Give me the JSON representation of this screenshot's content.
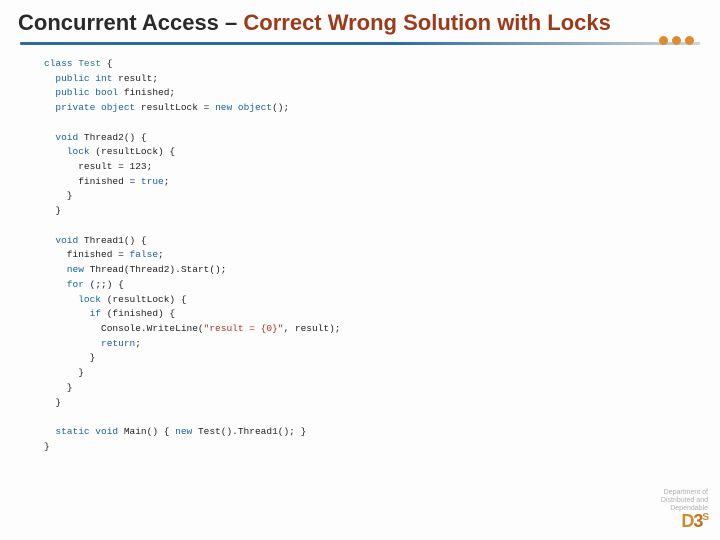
{
  "title": {
    "plain": "Concurrent Access – ",
    "accent": "Correct Wrong Solution with Locks"
  },
  "code": {
    "l01a": "class",
    "l01b": " Test",
    "l01c": " {",
    "l02a": "  public",
    "l02b": " int",
    "l02c": " result;",
    "l03a": "  public",
    "l03b": " bool",
    "l03c": " finished;",
    "l04a": "  private",
    "l04b": " object",
    "l04c": " resultLock = ",
    "l04d": "new",
    "l04e": " object",
    "l04f": "();",
    "blank": " ",
    "l05a": "  void",
    "l05b": " Thread2() {",
    "l06a": "    lock",
    "l06b": " (resultLock) {",
    "l07": "      result = 123;",
    "l08a": "      finished = ",
    "l08b": "true",
    "l08c": ";",
    "l09": "    }",
    "l10": "  }",
    "l11a": "  void",
    "l11b": " Thread1() {",
    "l12a": "    finished = ",
    "l12b": "false",
    "l12c": ";",
    "l13a": "    new",
    "l13b": " Thread(Thread2).Start();",
    "l14a": "    for",
    "l14b": " (;;) {",
    "l15a": "      lock",
    "l15b": " (resultLock) {",
    "l16a": "        if",
    "l16b": " (finished) {",
    "l17a": "          Console.WriteLine(",
    "l17b": "\"result = {0}\"",
    "l17c": ", result);",
    "l18a": "          return",
    "l18b": ";",
    "l19": "        }",
    "l20": "      }",
    "l21": "    }",
    "l22": "  }",
    "l23a": "  static",
    "l23b": " void",
    "l23c": " Main() { ",
    "l23d": "new",
    "l23e": " Test().Thread1(); }",
    "l24": "}"
  },
  "footer": {
    "line1": "Department of",
    "line2": "Distributed and",
    "line3": "Dependable",
    "logo": "D3S"
  }
}
